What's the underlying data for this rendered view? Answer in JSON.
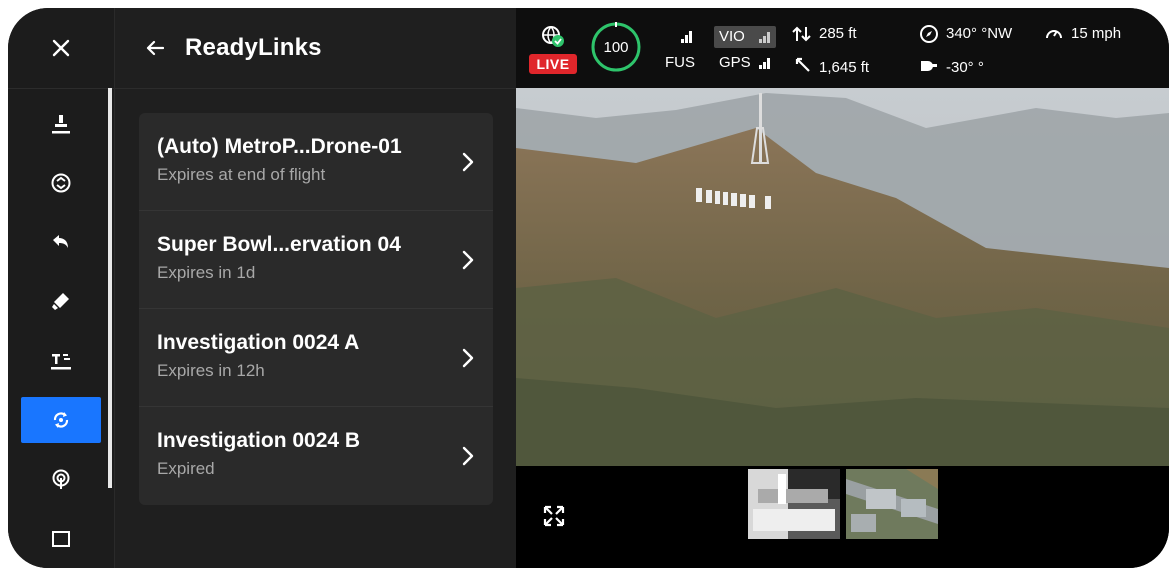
{
  "panel": {
    "title": "ReadyLinks",
    "items": [
      {
        "title": "(Auto) MetroP...Drone-01",
        "subtitle": "Expires at end of flight"
      },
      {
        "title": "Super Bowl...ervation 04",
        "subtitle": "Expires in 1d"
      },
      {
        "title": "Investigation 0024 A",
        "subtitle": "Expires in 12h"
      },
      {
        "title": "Investigation 0024 B",
        "subtitle": "Expired"
      }
    ]
  },
  "hud": {
    "live": "LIVE",
    "battery": "100",
    "battery_level": 1.0,
    "fus": "FUS",
    "vio": "VIO",
    "gps": "GPS",
    "altitude": "285 ft",
    "distance": "1,645 ft",
    "heading": "340° °NW",
    "speed": "15 mph",
    "gimbal": "-30° °"
  },
  "colors": {
    "accent": "#1976ff",
    "live": "#e0262b",
    "battery": "#2ec46b"
  },
  "icons": {
    "rail": [
      "close-icon",
      "launch-icon",
      "land-icon",
      "return-home-icon",
      "spotlight-icon",
      "perch-icon",
      "readylinks-icon",
      "signal-icon",
      "screen-icon"
    ]
  }
}
